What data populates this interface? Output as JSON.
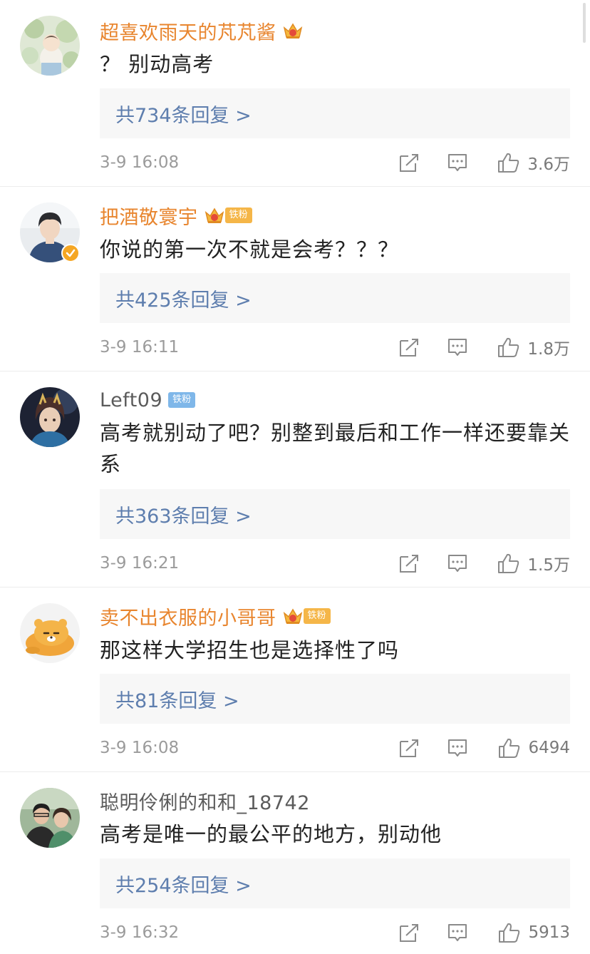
{
  "comments": [
    {
      "username": "超喜欢雨天的芃芃酱",
      "fan_badge": "",
      "text": "？ 别动高考",
      "replies_label": "共734条回复 >",
      "time": "3-9 16:08",
      "likes": "3.6万"
    },
    {
      "username": "把酒敬寰宇",
      "fan_badge": "铁粉",
      "text": "你说的第一次不就是会考？？？",
      "replies_label": "共425条回复 >",
      "time": "3-9 16:11",
      "likes": "1.8万"
    },
    {
      "username": "Left09",
      "fan_badge": "铁粉",
      "text": "高考就别动了吧？别整到最后和工作一样还要靠关系",
      "replies_label": "共363条回复 >",
      "time": "3-9 16:21",
      "likes": "1.5万"
    },
    {
      "username": "卖不出衣服的小哥哥",
      "fan_badge": "铁粉",
      "text": "那这样大学招生也是选择性了吗",
      "replies_label": "共81条回复 >",
      "time": "3-9 16:08",
      "likes": "6494"
    },
    {
      "username": "聪明伶俐的和和_18742",
      "fan_badge": "",
      "text": "高考是唯一的最公平的地方，别动他",
      "replies_label": "共254条回复 >",
      "time": "3-9 16:32",
      "likes": "5913"
    }
  ],
  "colors": {
    "vip_name": "#e8852e",
    "normal_name": "#5b5b5b",
    "reply_link": "#5e7eae",
    "reply_bg": "#f7f7f7",
    "meta_gray": "#9b9b9b"
  },
  "icons": {
    "share": "share-icon",
    "reply": "comment-icon",
    "like": "thumbs-up-icon",
    "crown": "crown-vip-icon",
    "verified": "verified-check-icon"
  }
}
